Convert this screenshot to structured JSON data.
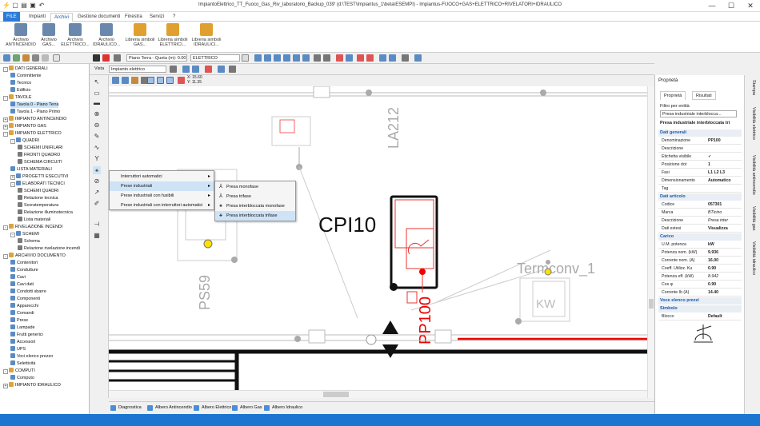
{
  "window": {
    "title": "ImpiantoElettrico_TT_Fuoco_Gas_Riv_laboratorio_Backup_039' (d:\\TEST\\Impiantus_1\\beta\\ESEMPI) - Impiantus-FUOCO+GAS+ELETTRICO+RIVELATORI+IDRAULICO",
    "minimize": "—",
    "maximize": "☐",
    "close": "✕"
  },
  "ribbon_tabs": [
    "FILE",
    "Impianti",
    "Archivi",
    "Gestione documenti",
    "Finestra",
    "Servizi",
    "?"
  ],
  "ribbon_buttons": [
    "Archivio ANTINCENDIO",
    "Archivio GAS...",
    "Archivio ELETTRICO...",
    "Archivio IDRAULICO...",
    "Libreria simboli GAS...",
    "Libreria simboli ELETTRICI...",
    "Libreria simboli IDRAULICI..."
  ],
  "tree": [
    {
      "label": "DATI GENERALI",
      "level": 0,
      "exp": "-"
    },
    {
      "label": "Committente",
      "level": 1
    },
    {
      "label": "Tecnico",
      "level": 1
    },
    {
      "label": "Edificio",
      "level": 1
    },
    {
      "label": "TAVOLE",
      "level": 0,
      "exp": "-"
    },
    {
      "label": "Tavola 0 - Piano Terra",
      "level": 1,
      "sel": true
    },
    {
      "label": "Tavola 1 - Piano Primo",
      "level": 1
    },
    {
      "label": "IMPIANTO ANTINCENDIO",
      "level": 0,
      "exp": "+"
    },
    {
      "label": "IMPIANTO GAS",
      "level": 0,
      "exp": "+"
    },
    {
      "label": "IMPIANTO ELETTRICO",
      "level": 0,
      "exp": "-"
    },
    {
      "label": "QUADRI",
      "level": 1,
      "exp": "-"
    },
    {
      "label": "SCHEMI UNIFILARI",
      "level": 2
    },
    {
      "label": "FRONTI QUADRO",
      "level": 2
    },
    {
      "label": "SCHEMA CIRCUITI",
      "level": 2
    },
    {
      "label": "LISTA MATERIALI",
      "level": 1
    },
    {
      "label": "PROGETTI ESECUTIVI",
      "level": 1,
      "exp": "+"
    },
    {
      "label": "ELABORATI TECNICI",
      "level": 1,
      "exp": "-"
    },
    {
      "label": "SCHEMI QUADRI",
      "level": 2
    },
    {
      "label": "Relazione tecnica",
      "level": 2
    },
    {
      "label": "Sovratemperatura",
      "level": 2
    },
    {
      "label": "Relazione illuminotecnica",
      "level": 2
    },
    {
      "label": "Lista materiali",
      "level": 2
    },
    {
      "label": "RIVELAZIONE INCENDI",
      "level": 0,
      "exp": "-"
    },
    {
      "label": "SCHEMI",
      "level": 1,
      "exp": "-"
    },
    {
      "label": "Schema",
      "level": 2
    },
    {
      "label": "Relazione rivelazione incendi",
      "level": 2
    },
    {
      "label": "ARCHIVIO DOCUMENTO",
      "level": 0,
      "exp": "-"
    },
    {
      "label": "Contenitori",
      "level": 1
    },
    {
      "label": "Condutture",
      "level": 1
    },
    {
      "label": "Cavi",
      "level": 1
    },
    {
      "label": "Cavi dati",
      "level": 1
    },
    {
      "label": "Condotti sbarre",
      "level": 1
    },
    {
      "label": "Componenti",
      "level": 1
    },
    {
      "label": "Apparecchi",
      "level": 1
    },
    {
      "label": "Comandi",
      "level": 1
    },
    {
      "label": "Prese",
      "level": 1
    },
    {
      "label": "Lampade",
      "level": 1
    },
    {
      "label": "Frutti generici",
      "level": 1
    },
    {
      "label": "Accessori",
      "level": 1
    },
    {
      "label": "UPS",
      "level": 1
    },
    {
      "label": "Voci elenco prezzo",
      "level": 1
    },
    {
      "label": "Selettività",
      "level": 1
    },
    {
      "label": "COMPUTI",
      "level": 0,
      "exp": "-"
    },
    {
      "label": "Computo",
      "level": 1
    },
    {
      "label": "IMPIANTO IDRAULICO",
      "level": 0,
      "exp": "+"
    }
  ],
  "toolbar": {
    "floor_label": "Piano Terra - Quota (m): 0.00",
    "layer_value": "ELETTRICO",
    "view_label": "Vista",
    "view_value": "Impianto elettrico",
    "coord_x": "X: 15.60",
    "coord_y": "Y: 11.35"
  },
  "context_menu": {
    "items": [
      "Interruttori automatici",
      "Prese industriali",
      "Prese industriali con fusibili",
      "Prese industriali con interruttori automatici"
    ],
    "highlighted_index": 1
  },
  "submenu": {
    "items": [
      "Presa monofase",
      "Presa trifase",
      "Presa interbloccata monofase",
      "Presa interbloccata trifase"
    ],
    "highlighted_index": 3
  },
  "canvas": {
    "labels": [
      "LA212",
      "CPI10",
      "Termconv_1",
      "PS59",
      "PP100",
      "KW"
    ]
  },
  "properties": {
    "title": "Proprietà",
    "tabs": [
      "Proprietà",
      "Risultati"
    ],
    "filter_label": "Filtro per entità",
    "filter_value": "Presa industriale interblocca...",
    "entity_title": "Presa industriale interbloccata tri",
    "sections": [
      {
        "title": "Dati generali",
        "rows": [
          {
            "k": "Denominazione",
            "v": "PP100"
          },
          {
            "k": "Descrizione",
            "v": ""
          },
          {
            "k": "Etichetta visibile",
            "v": "✓"
          },
          {
            "k": "Posizione dot",
            "v": "1"
          },
          {
            "k": "Fasi",
            "v": "L1 L2 L3"
          },
          {
            "k": "Dimensionamento",
            "v": "Automatico"
          },
          {
            "k": "Tag",
            "v": ""
          }
        ]
      },
      {
        "title": "Dati articolo",
        "rows": [
          {
            "k": "Codice",
            "v": "057301"
          },
          {
            "k": "Marca",
            "v": "BTicino",
            "it": true
          },
          {
            "k": "Descrizione",
            "v": "Presa inter",
            "it": true
          },
          {
            "k": "Dati estesi",
            "v": "Visualizza"
          }
        ]
      },
      {
        "title": "Carico",
        "rows": [
          {
            "k": "U.M. potenza",
            "v": "kW"
          },
          {
            "k": "Potenza nom. (kW)",
            "v": "9.936"
          },
          {
            "k": "Corrente nom. (A)",
            "v": "16.00"
          },
          {
            "k": "Coeff. Utilizz. Ku",
            "v": "0.90"
          },
          {
            "k": "Potenza eff. (kW)",
            "v": "8.942",
            "it": true
          },
          {
            "k": "Cos φ",
            "v": "0.90"
          },
          {
            "k": "Corrente Ib (A)",
            "v": "14.40"
          }
        ]
      },
      {
        "title": "Voce elenco prezzi",
        "rows": []
      },
      {
        "title": "Simbolo",
        "rows": [
          {
            "k": "Blocco",
            "v": "Default"
          }
        ]
      }
    ]
  },
  "side_tabs": [
    "Stampa",
    "Visibilità elettrico",
    "Visibilità antincendio",
    "Visibilità gas",
    "Visibilità idraulico"
  ],
  "bottom_tabs": [
    "Diagnostica",
    "Albero Antincendio",
    "Albero Elettrico",
    "Albero Gas",
    "Albero Idraulico"
  ],
  "colors": {
    "accent": "#1c75cf",
    "red_line": "#e00000",
    "yellow_lamp": "#ffe000"
  }
}
